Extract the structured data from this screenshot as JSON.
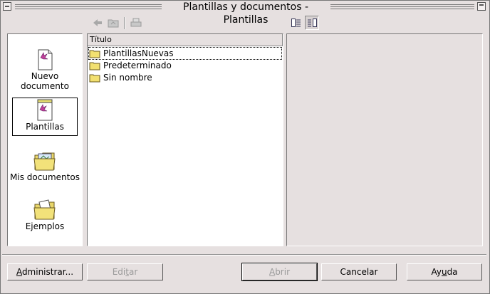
{
  "window": {
    "title": "Plantillas y documentos - Plantillas"
  },
  "toolbar": {
    "back_icon": "left-arrow-icon",
    "up_icon": "folder-up-icon",
    "print_icon": "printer-icon",
    "view_list_icon": "document-view-icon",
    "view_preview_icon": "preview-view-icon"
  },
  "categories": [
    {
      "label_line1": "Nuevo",
      "label_line2": "documento",
      "icon": "new-document-icon"
    },
    {
      "label": "Plantillas",
      "icon": "templates-icon",
      "selected": true
    },
    {
      "label": "Mis documentos",
      "icon": "my-documents-folder-icon"
    },
    {
      "label": "Ejemplos",
      "icon": "examples-folder-icon"
    }
  ],
  "list": {
    "column_header": "Título",
    "items": [
      {
        "name": "PlantillasNuevas",
        "icon": "folder-icon"
      },
      {
        "name": "Predeterminado",
        "icon": "folder-icon"
      },
      {
        "name": "Sin nombre",
        "icon": "folder-icon"
      }
    ]
  },
  "buttons": {
    "administrar": {
      "pre": "",
      "mn": "A",
      "post": "dministrar..."
    },
    "editar": {
      "pre": "Edi",
      "mn": "t",
      "post": "ar"
    },
    "abrir": {
      "pre": "",
      "mn": "A",
      "post": "brir"
    },
    "cancelar": {
      "pre": "",
      "mn": "",
      "post": "Cancelar"
    },
    "ayuda": {
      "pre": "Ay",
      "mn": "u",
      "post": "da"
    }
  }
}
